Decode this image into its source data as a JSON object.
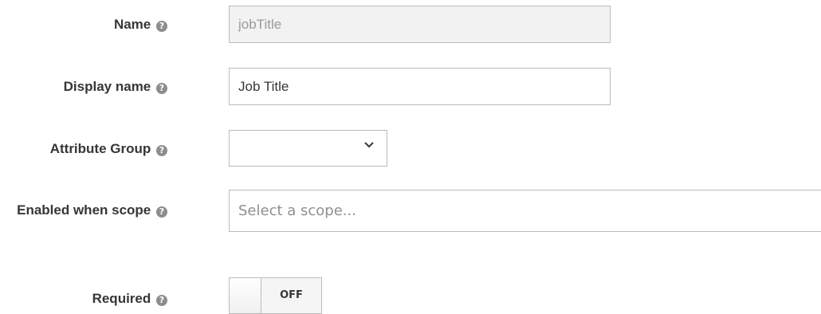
{
  "fields": {
    "name": {
      "label": "Name",
      "value": "jobTitle",
      "help_icon": "question-circle-icon"
    },
    "display_name": {
      "label": "Display name",
      "value": "Job Title",
      "help_icon": "question-circle-icon"
    },
    "attribute_group": {
      "label": "Attribute Group",
      "value": "",
      "help_icon": "question-circle-icon"
    },
    "enabled_when_scope": {
      "label": "Enabled when scope",
      "placeholder": "Select a scope...",
      "help_icon": "question-circle-icon"
    },
    "required": {
      "label": "Required",
      "toggle_state": "OFF",
      "help_icon": "question-circle-icon"
    }
  },
  "icons": {
    "help": "?"
  }
}
